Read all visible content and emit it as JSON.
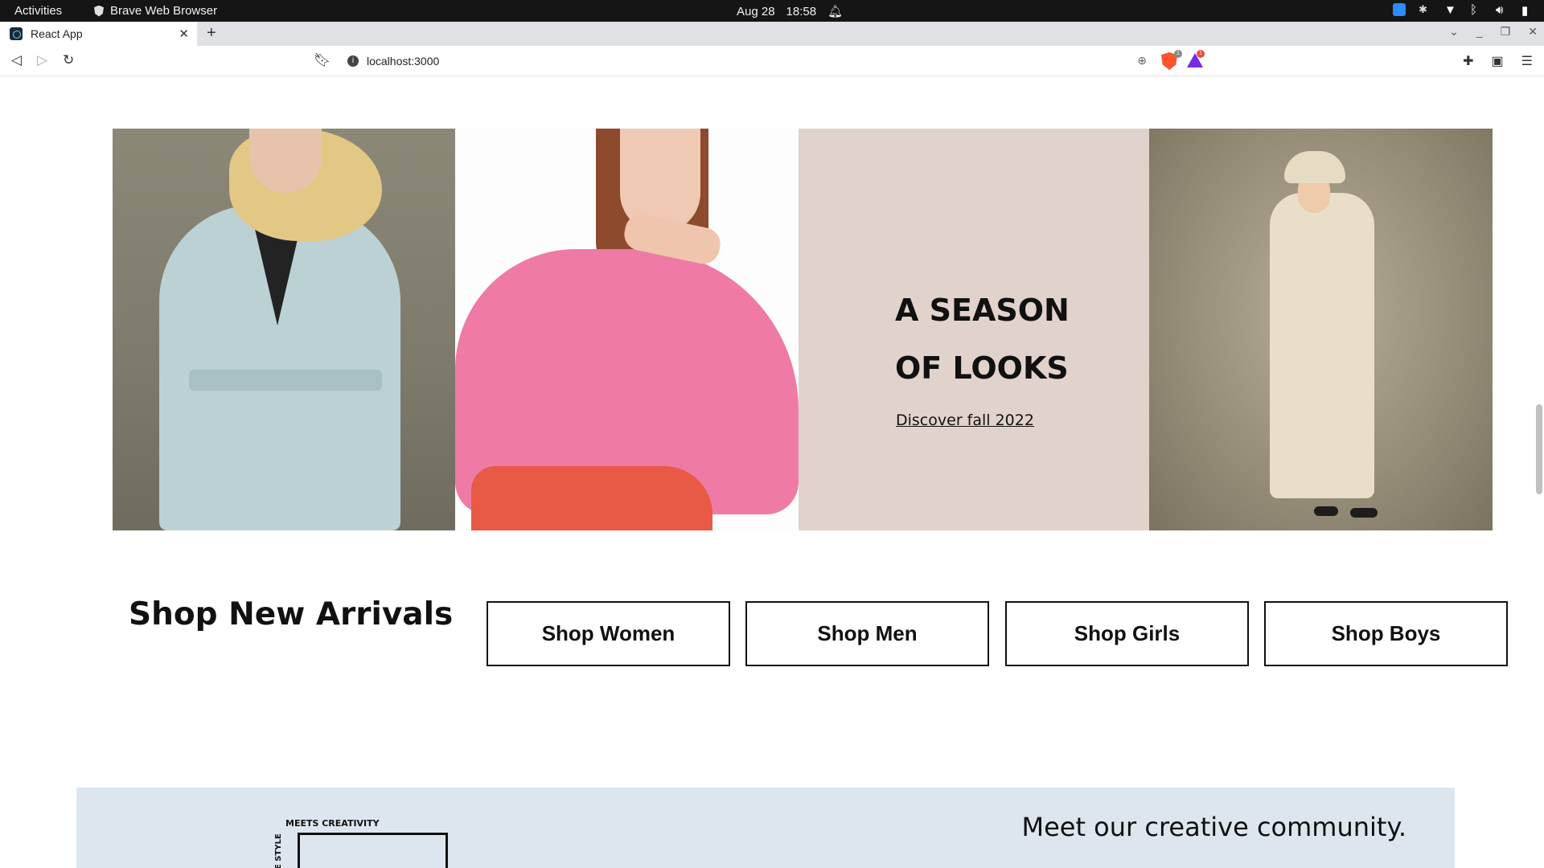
{
  "os_bar": {
    "activities": "Activities",
    "app_name": "Brave Web Browser",
    "date": "Aug 28",
    "time": "18:58"
  },
  "browser": {
    "tab_title": "React App",
    "url": "localhost:3000",
    "shield_badge": "1",
    "rewards_badge": "1"
  },
  "hero": {
    "promo_title": "A SEASON OF LOOKS",
    "promo_link": "Discover fall 2022",
    "panel_colors": {
      "promo_bg": "#e1d3cc"
    }
  },
  "arrivals": {
    "title": "Shop New Arrivals",
    "buttons": [
      "Shop Women",
      "Shop Men",
      "Shop Girls",
      "Shop Boys"
    ]
  },
  "community": {
    "logo_top": "MEETS CREATIVITY",
    "logo_side": "E STYLE",
    "heading": "Meet our creative community.",
    "bg_color": "#dde6ee"
  },
  "icons": {
    "back": "back-arrow-icon",
    "forward": "forward-arrow-icon",
    "reload": "reload-icon",
    "bookmark": "bookmark-icon",
    "zoom": "zoom-icon",
    "extensions": "puzzle-icon",
    "wallet": "wallet-icon",
    "menu": "hamburger-menu-icon"
  }
}
